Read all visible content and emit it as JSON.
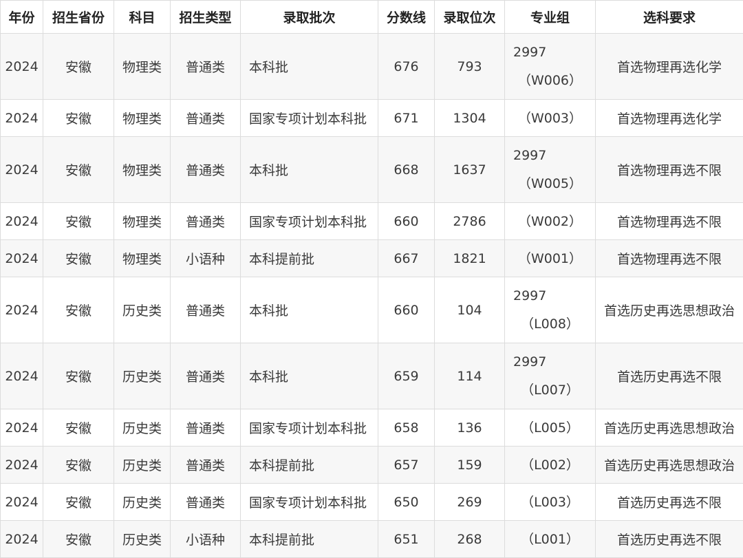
{
  "columns": [
    "年份",
    "招生省份",
    "科目",
    "招生类型",
    "录取批次",
    "分数线",
    "录取位次",
    "专业组",
    "选科要求"
  ],
  "rows": [
    {
      "year": "2024",
      "province": "安徽",
      "subject": "物理类",
      "type": "普通类",
      "batch": "本科批",
      "score": "676",
      "rank": "793",
      "group_code": "2997",
      "group_name": "（W006）",
      "requirement": "首选物理再选化学"
    },
    {
      "year": "2024",
      "province": "安徽",
      "subject": "物理类",
      "type": "普通类",
      "batch": "国家专项计划本科批",
      "score": "671",
      "rank": "1304",
      "group_code": "",
      "group_name": "（W003）",
      "requirement": "首选物理再选化学"
    },
    {
      "year": "2024",
      "province": "安徽",
      "subject": "物理类",
      "type": "普通类",
      "batch": "本科批",
      "score": "668",
      "rank": "1637",
      "group_code": "2997",
      "group_name": "（W005）",
      "requirement": "首选物理再选不限"
    },
    {
      "year": "2024",
      "province": "安徽",
      "subject": "物理类",
      "type": "普通类",
      "batch": "国家专项计划本科批",
      "score": "660",
      "rank": "2786",
      "group_code": "",
      "group_name": "（W002）",
      "requirement": "首选物理再选不限"
    },
    {
      "year": "2024",
      "province": "安徽",
      "subject": "物理类",
      "type": "小语种",
      "batch": "本科提前批",
      "score": "667",
      "rank": "1821",
      "group_code": "",
      "group_name": "（W001）",
      "requirement": "首选物理再选不限"
    },
    {
      "year": "2024",
      "province": "安徽",
      "subject": "历史类",
      "type": "普通类",
      "batch": "本科批",
      "score": "660",
      "rank": "104",
      "group_code": "2997",
      "group_name": "（L008）",
      "requirement": "首选历史再选思想政治"
    },
    {
      "year": "2024",
      "province": "安徽",
      "subject": "历史类",
      "type": "普通类",
      "batch": "本科批",
      "score": "659",
      "rank": "114",
      "group_code": "2997",
      "group_name": "（L007）",
      "requirement": "首选历史再选不限"
    },
    {
      "year": "2024",
      "province": "安徽",
      "subject": "历史类",
      "type": "普通类",
      "batch": "国家专项计划本科批",
      "score": "658",
      "rank": "136",
      "group_code": "",
      "group_name": "（L005）",
      "requirement": "首选历史再选思想政治"
    },
    {
      "year": "2024",
      "province": "安徽",
      "subject": "历史类",
      "type": "普通类",
      "batch": "本科提前批",
      "score": "657",
      "rank": "159",
      "group_code": "",
      "group_name": "（L002）",
      "requirement": "首选历史再选思想政治"
    },
    {
      "year": "2024",
      "province": "安徽",
      "subject": "历史类",
      "type": "普通类",
      "batch": "国家专项计划本科批",
      "score": "650",
      "rank": "269",
      "group_code": "",
      "group_name": "（L003）",
      "requirement": "首选历史再选不限"
    },
    {
      "year": "2024",
      "province": "安徽",
      "subject": "历史类",
      "type": "小语种",
      "batch": "本科提前批",
      "score": "651",
      "rank": "268",
      "group_code": "",
      "group_name": "（L001）",
      "requirement": "首选历史再选不限"
    }
  ]
}
